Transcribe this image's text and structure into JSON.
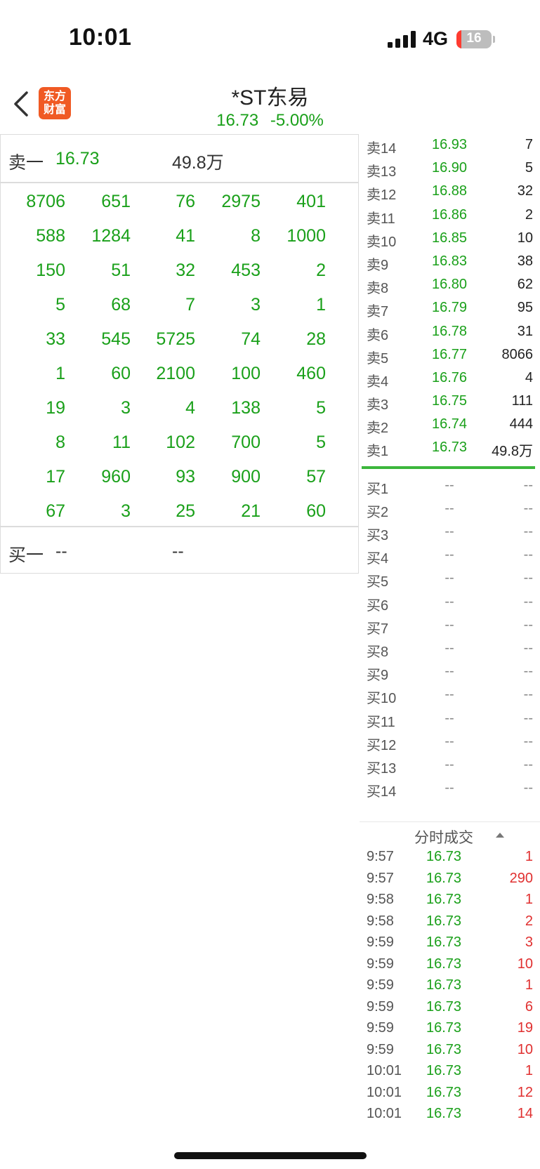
{
  "status": {
    "time": "10:01",
    "network": "4G",
    "battery": "16"
  },
  "header": {
    "logo_line1": "东方",
    "logo_line2": "财富",
    "title": "*ST东易",
    "price": "16.73",
    "change_pct": "-5.00%"
  },
  "ask_summary": {
    "label": "卖一",
    "price": "16.73",
    "volume": "49.8万"
  },
  "bid_summary": {
    "label": "买一",
    "price": "--",
    "volume": "--"
  },
  "queue_grid": [
    [
      "8706",
      "651",
      "76",
      "2975",
      "401"
    ],
    [
      "588",
      "1284",
      "41",
      "8",
      "1000"
    ],
    [
      "150",
      "51",
      "32",
      "453",
      "2"
    ],
    [
      "5",
      "68",
      "7",
      "3",
      "1"
    ],
    [
      "33",
      "545",
      "5725",
      "74",
      "28"
    ],
    [
      "1",
      "60",
      "2100",
      "100",
      "460"
    ],
    [
      "19",
      "3",
      "4",
      "138",
      "5"
    ],
    [
      "8",
      "11",
      "102",
      "700",
      "5"
    ],
    [
      "17",
      "960",
      "93",
      "900",
      "57"
    ],
    [
      "67",
      "3",
      "25",
      "21",
      "60"
    ]
  ],
  "asks": [
    {
      "label": "卖14",
      "price": "16.93",
      "vol": "7"
    },
    {
      "label": "卖13",
      "price": "16.90",
      "vol": "5"
    },
    {
      "label": "卖12",
      "price": "16.88",
      "vol": "32"
    },
    {
      "label": "卖11",
      "price": "16.86",
      "vol": "2"
    },
    {
      "label": "卖10",
      "price": "16.85",
      "vol": "10"
    },
    {
      "label": "卖9",
      "price": "16.83",
      "vol": "38"
    },
    {
      "label": "卖8",
      "price": "16.80",
      "vol": "62"
    },
    {
      "label": "卖7",
      "price": "16.79",
      "vol": "95"
    },
    {
      "label": "卖6",
      "price": "16.78",
      "vol": "31"
    },
    {
      "label": "卖5",
      "price": "16.77",
      "vol": "8066"
    },
    {
      "label": "卖4",
      "price": "16.76",
      "vol": "4"
    },
    {
      "label": "卖3",
      "price": "16.75",
      "vol": "111"
    },
    {
      "label": "卖2",
      "price": "16.74",
      "vol": "444"
    },
    {
      "label": "卖1",
      "price": "16.73",
      "vol": "49.8万"
    }
  ],
  "bids": [
    {
      "label": "买1",
      "price": "--",
      "vol": "--"
    },
    {
      "label": "买2",
      "price": "--",
      "vol": "--"
    },
    {
      "label": "买3",
      "price": "--",
      "vol": "--"
    },
    {
      "label": "买4",
      "price": "--",
      "vol": "--"
    },
    {
      "label": "买5",
      "price": "--",
      "vol": "--"
    },
    {
      "label": "买6",
      "price": "--",
      "vol": "--"
    },
    {
      "label": "买7",
      "price": "--",
      "vol": "--"
    },
    {
      "label": "买8",
      "price": "--",
      "vol": "--"
    },
    {
      "label": "买9",
      "price": "--",
      "vol": "--"
    },
    {
      "label": "买10",
      "price": "--",
      "vol": "--"
    },
    {
      "label": "买11",
      "price": "--",
      "vol": "--"
    },
    {
      "label": "买12",
      "price": "--",
      "vol": "--"
    },
    {
      "label": "买13",
      "price": "--",
      "vol": "--"
    },
    {
      "label": "买14",
      "price": "--",
      "vol": "--"
    }
  ],
  "ticks_title": "分时成交",
  "ticks": [
    {
      "time": "9:57",
      "price": "16.73",
      "vol": "1"
    },
    {
      "time": "9:57",
      "price": "16.73",
      "vol": "290"
    },
    {
      "time": "9:58",
      "price": "16.73",
      "vol": "1"
    },
    {
      "time": "9:58",
      "price": "16.73",
      "vol": "2"
    },
    {
      "time": "9:59",
      "price": "16.73",
      "vol": "3"
    },
    {
      "time": "9:59",
      "price": "16.73",
      "vol": "10"
    },
    {
      "time": "9:59",
      "price": "16.73",
      "vol": "1"
    },
    {
      "time": "9:59",
      "price": "16.73",
      "vol": "6"
    },
    {
      "time": "9:59",
      "price": "16.73",
      "vol": "19"
    },
    {
      "time": "9:59",
      "price": "16.73",
      "vol": "10"
    },
    {
      "time": "10:01",
      "price": "16.73",
      "vol": "1"
    },
    {
      "time": "10:01",
      "price": "16.73",
      "vol": "12"
    },
    {
      "time": "10:01",
      "price": "16.73",
      "vol": "14"
    }
  ],
  "colors": {
    "down": "#1aa01a",
    "up": "#e03030",
    "brand": "#f05a24"
  }
}
